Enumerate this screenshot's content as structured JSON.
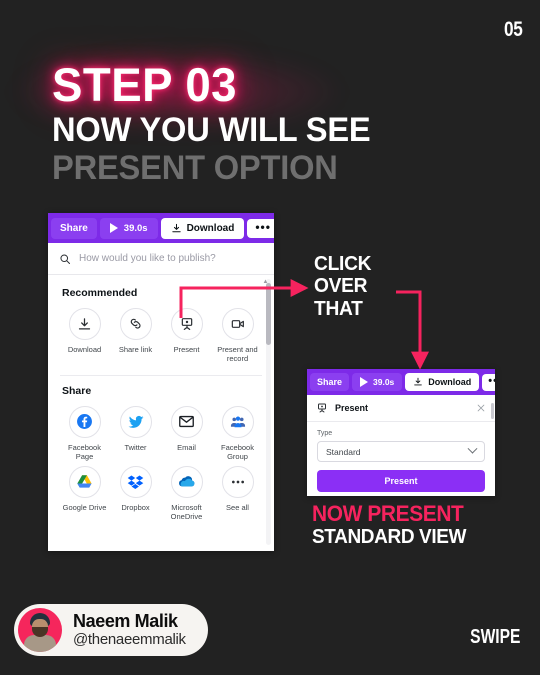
{
  "page": {
    "number": "05",
    "background": "#222222"
  },
  "headline": {
    "step": "STEP 03",
    "line2": "NOW YOU WILL SEE",
    "line3": "PRESENT OPTION",
    "neon_color": "#ff1a66",
    "muted_color": "#6f6f6f"
  },
  "callout": {
    "line1": "CLICK",
    "line2": "OVER",
    "line3": "THAT"
  },
  "caption": {
    "line1": "NOW PRESENT",
    "line2": "STANDARD VIEW",
    "accent": "#f6235e"
  },
  "left_panel": {
    "toolbar": {
      "share_label": "Share",
      "timer_label": "39.0s",
      "download_label": "Download",
      "more_label": "•••",
      "bar_color": "#7d2ae8",
      "button_color": "#8b3ff0"
    },
    "search": {
      "placeholder": "How would you like to publish?",
      "icon": "search-icon"
    },
    "recommended": {
      "title": "Recommended",
      "items": [
        {
          "label": "Download",
          "icon": "download-icon"
        },
        {
          "label": "Share link",
          "icon": "link-icon"
        },
        {
          "label": "Present",
          "icon": "present-icon"
        },
        {
          "label": "Present and record",
          "icon": "present-record-icon"
        }
      ]
    },
    "share": {
      "title": "Share",
      "items": [
        {
          "label": "Facebook Page",
          "icon": "facebook-icon"
        },
        {
          "label": "Twitter",
          "icon": "twitter-icon"
        },
        {
          "label": "Email",
          "icon": "email-icon"
        },
        {
          "label": "Facebook Group",
          "icon": "facebook-group-icon"
        },
        {
          "label": "Google Drive",
          "icon": "google-drive-icon"
        },
        {
          "label": "Dropbox",
          "icon": "dropbox-icon"
        },
        {
          "label": "Microsoft OneDrive",
          "icon": "onedrive-icon"
        },
        {
          "label": "See all",
          "icon": "ellipsis-icon"
        }
      ]
    }
  },
  "right_panel": {
    "toolbar": {
      "share_label": "Share",
      "timer_label": "39.0s",
      "download_label": "Download",
      "more_label": "•••"
    },
    "dialog": {
      "title": "Present",
      "close_label": "×",
      "type_label": "Type",
      "type_value": "Standard",
      "present_button": "Present",
      "button_color": "#8b2ff5"
    }
  },
  "footer": {
    "name": "Naeem Malik",
    "handle": "@thenaeemmalik",
    "swipe_label": "SWIPE"
  }
}
